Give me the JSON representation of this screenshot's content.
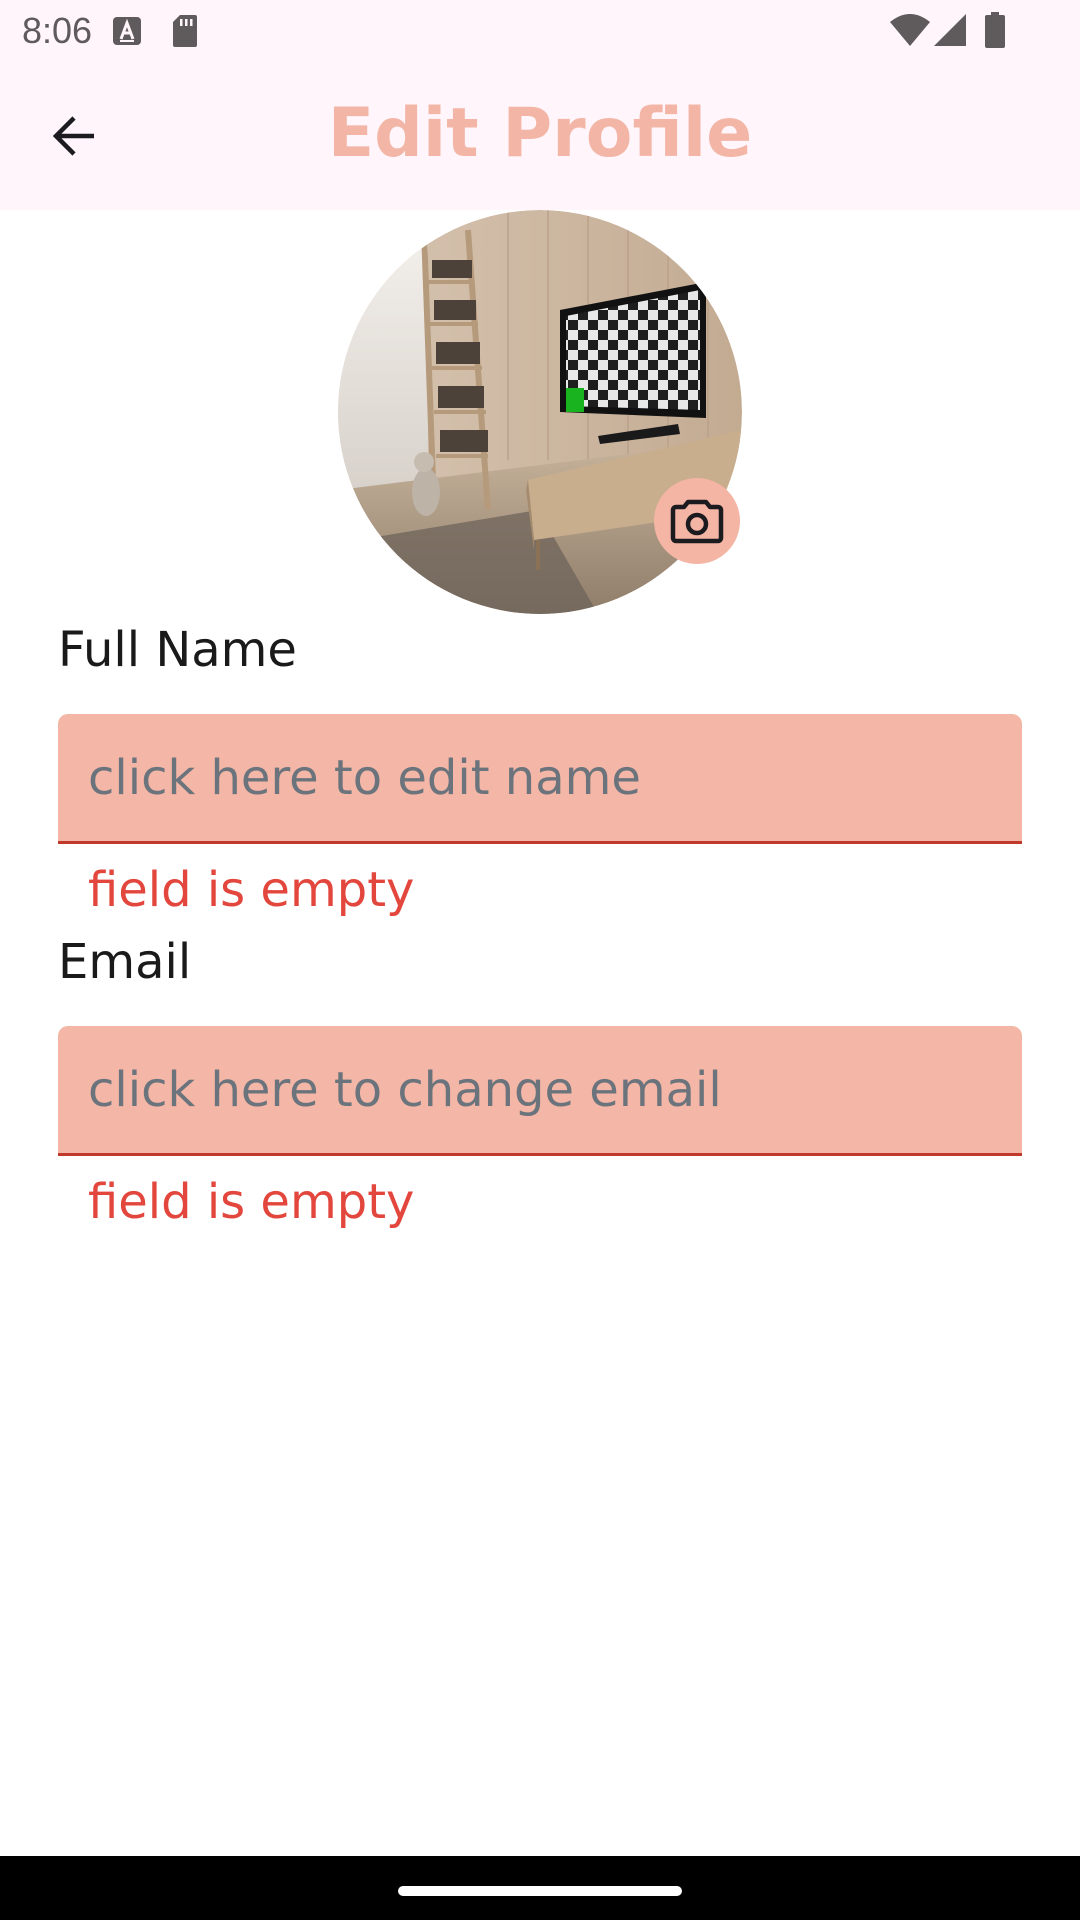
{
  "status_bar": {
    "time": "8:06",
    "icons": [
      "a-notification-icon",
      "sd-card-icon",
      "wifi-icon",
      "signal-icon",
      "battery-icon"
    ]
  },
  "app_bar": {
    "title": "Edit Profile",
    "back_icon": "arrow-back-icon",
    "title_color": "#f3b6a6"
  },
  "avatar": {
    "camera_icon": "camera-icon",
    "camera_bg": "#f4b5a4"
  },
  "form": {
    "name": {
      "label": "Full Name",
      "placeholder": "click here to edit name",
      "value": "",
      "error": "field is empty"
    },
    "email": {
      "label": "Email",
      "placeholder": "click here to change email",
      "value": "",
      "error": "field is empty"
    }
  },
  "colors": {
    "input_fill": "#f4b6a6",
    "error": "#e2463c",
    "bar_bg": "#fff5fb"
  }
}
